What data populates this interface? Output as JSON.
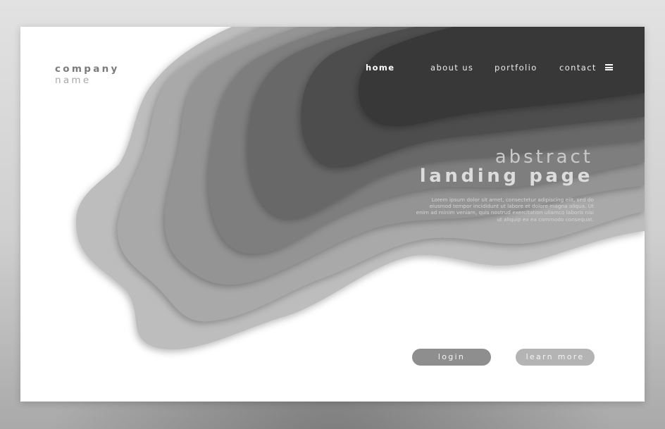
{
  "brand": {
    "line1": "company",
    "line2": "name"
  },
  "nav": {
    "items": [
      {
        "label": "home",
        "active": true
      },
      {
        "label": "about us",
        "active": false
      },
      {
        "label": "portfolio",
        "active": false
      },
      {
        "label": "contact",
        "active": false
      }
    ],
    "menu_icon": "hamburger-menu-icon"
  },
  "hero": {
    "title_line1": "abstract",
    "title_line2": "landing page",
    "body_lines": [
      "Lorem ipsum dolor sit amet, consectetur adipiscing elit, sed do",
      "eiusmod tempor incididunt ut labore et dolore magna aliqua. Ut",
      "enim ad minim veniam, quis nostrud exercitation ullamco laboris nisi",
      "ut aliquip ex ea commodo consequat."
    ]
  },
  "actions": {
    "login_label": "login",
    "learn_more_label": "learn more"
  },
  "colors": {
    "page_bg": "#d6d6d6",
    "card_bg": "#ffffff",
    "wave_layers": [
      "#bdbdbd",
      "#a9a9a9",
      "#949494",
      "#7e7e7e",
      "#676767",
      "#4e4e4e",
      "#393939"
    ],
    "login_button": "#8e8e8e",
    "learn_more_button": "#b4b4b4"
  }
}
